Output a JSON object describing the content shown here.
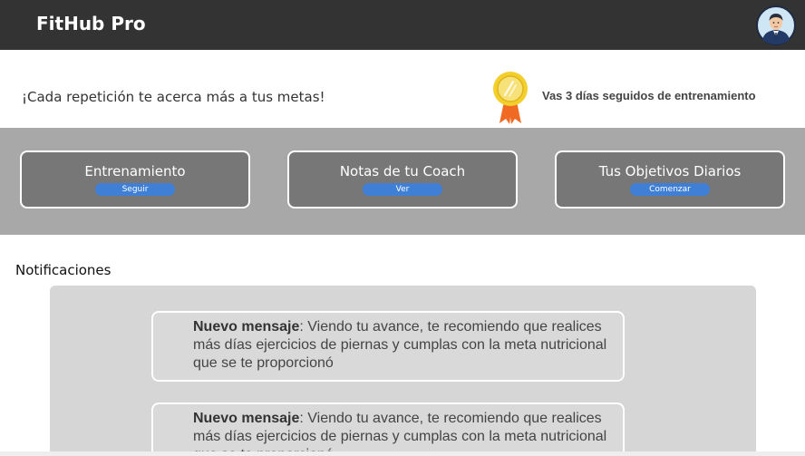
{
  "header": {
    "brand": "FitHub Pro",
    "avatar_icon": "user-avatar-icon"
  },
  "hero": {
    "motivation": "¡Cada repetición te acerca más a tus metas!",
    "medal_icon": "medal-icon",
    "streak": "Vas 3 días seguidos de entrenamiento"
  },
  "cards": [
    {
      "title": "Entrenamiento",
      "button": "Seguir"
    },
    {
      "title": "Notas de tu Coach",
      "button": "Ver"
    },
    {
      "title": "Tus Objetivos Diarios",
      "button": "Comenzar"
    }
  ],
  "notifications": {
    "heading": "Notificaciones",
    "items": [
      {
        "label": "Nuevo mensaje",
        "text": ": Viendo tu avance, te recomiendo que realices más días ejercicios de piernas y cumplas con la meta nutricional que se te proporcionó"
      },
      {
        "label": "Nuevo mensaje",
        "text": ": Viendo tu avance, te recomiendo que realices más días ejercicios de piernas y cumplas con la meta nutricional que se te proporcionó"
      }
    ]
  },
  "colors": {
    "topbar": "#333333",
    "band": "#a8a8a8",
    "card": "#777777",
    "button": "#3f80d6",
    "medal_gold": "#f2cf2a",
    "ribbon": "#f06a23"
  }
}
